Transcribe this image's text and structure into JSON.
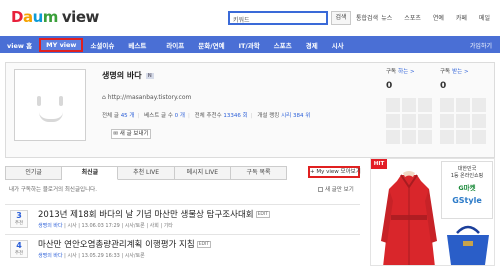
{
  "header": {
    "logo": {
      "d": "D",
      "a": "a",
      "u": "u",
      "m": "m",
      "view": "view"
    },
    "search_value": "키워드",
    "search_button": "검색",
    "unified_search": "통합검색",
    "top_links": [
      "뉴스",
      "스포츠",
      "연예",
      "카페",
      "메일"
    ]
  },
  "nav": {
    "items": [
      "view 홈",
      "MY view",
      "소셜이슈",
      "베스트",
      "라이프",
      "문화/연예",
      "IT/과학",
      "스포츠",
      "경제",
      "시사"
    ],
    "active_index": 1,
    "right": "가입하기"
  },
  "profile": {
    "blog_name": "생명의 바다",
    "badge": "N",
    "url": "http://masanbay.tistory.com",
    "stats": {
      "total_label": "전체 글",
      "total": "45 개",
      "best_label": "베스트 글 수",
      "best": "0 개",
      "total_views_label": "전체 추천수",
      "total_views": "13346 회",
      "score_label": "개설 랭킹",
      "score": "시리 384 위"
    },
    "message_button": "새 글 보내기",
    "subscribers": {
      "title": "구독",
      "link": "하는 >",
      "count": "0"
    },
    "subscribing": {
      "title": "구독",
      "link": "받는 >",
      "count": "0"
    }
  },
  "tabs": [
    "인기글",
    "최신글",
    "추천 LIVE",
    "메시지 LIVE",
    "구독 목록"
  ],
  "active_tab": 1,
  "myview_button": "+ My view 모아보기",
  "subtext": "내가 구독하는 블로거의 최신글입니다.",
  "check_label": "새 글만 보기",
  "posts": [
    {
      "count": "3",
      "count_label": "추천",
      "title": "2013년 제18회 바다의 날 기념 마산만 생물상 탐구조사대회",
      "tag": "EDIT",
      "author": "생명의 바다",
      "category": "시사",
      "time": "13.06.03 17:29",
      "extra": "시사/토론 | 사회 | 기타"
    },
    {
      "count": "4",
      "count_label": "추천",
      "title": "마산만 연안오염총량관리계획 이행평가 지침",
      "tag": "EDIT",
      "author": "생명의 바다",
      "category": "시사",
      "time": "13.05.29 16:33",
      "extra": "시사/토론"
    }
  ],
  "ad": {
    "hit": "HIT",
    "line1": "대한민국",
    "line2": "1등 온라인쇼핑",
    "brand": "G마켓",
    "gs": "GStyle"
  },
  "colors": {
    "nav_bg": "#4a6fd5",
    "highlight": "#e02020",
    "link": "#2b5fd8"
  }
}
